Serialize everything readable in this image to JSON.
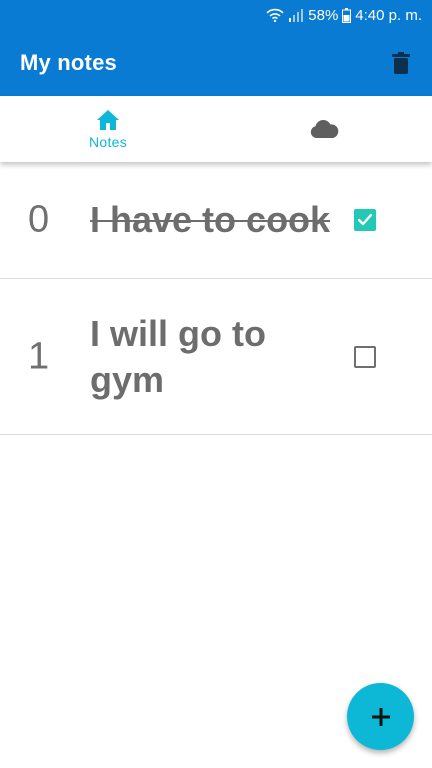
{
  "status_bar": {
    "battery": "58%",
    "time": "4:40 p. m.",
    "icons": [
      "wifi-icon",
      "signal-icon",
      "battery-icon"
    ]
  },
  "app_bar": {
    "title": "My notes",
    "delete_icon": "trash-icon",
    "color": "#0a7bd3"
  },
  "tabs": [
    {
      "label": "Notes",
      "icon": "home-icon",
      "active": true,
      "color": "#0db8d6"
    },
    {
      "label": "",
      "icon": "cloud-icon",
      "active": false,
      "color": "#5f5f5f"
    }
  ],
  "notes": [
    {
      "index": "0",
      "text": "I have to cook",
      "done": true
    },
    {
      "index": "1",
      "text": "I will go to gym",
      "done": false
    }
  ],
  "fab": {
    "icon": "plus-icon",
    "color": "#0db8d6"
  },
  "colors": {
    "checked": "#22c9b5",
    "text": "#6d6d6d"
  }
}
